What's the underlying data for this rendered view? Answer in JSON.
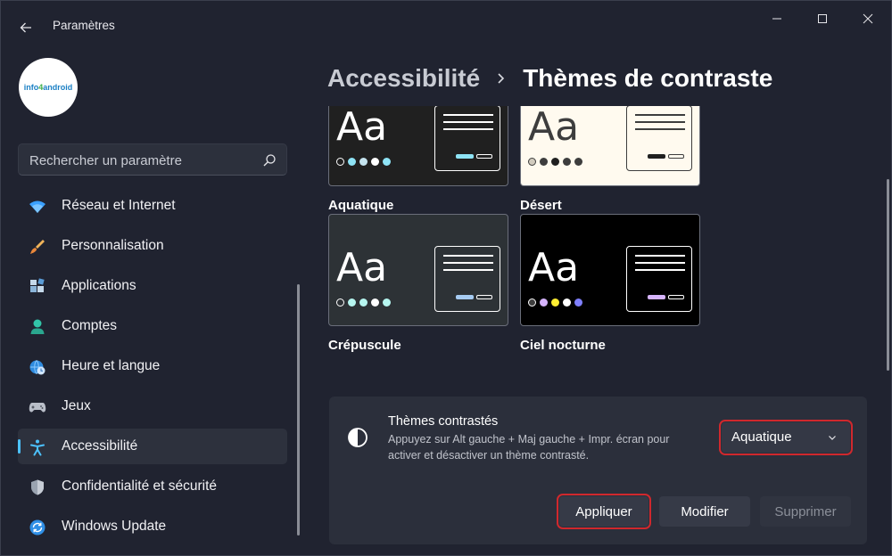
{
  "window": {
    "title": "Paramètres",
    "controls": [
      "minimize-icon",
      "maximize-icon",
      "close-icon"
    ]
  },
  "profile": {
    "logo_text_a": "info",
    "logo_text_b": "4",
    "logo_text_c": "android"
  },
  "search": {
    "placeholder": "Rechercher un paramètre"
  },
  "sidebar": {
    "items": [
      {
        "label": "Réseau et Internet",
        "icon": "wifi-icon"
      },
      {
        "label": "Personnalisation",
        "icon": "brush-icon"
      },
      {
        "label": "Applications",
        "icon": "apps-icon"
      },
      {
        "label": "Comptes",
        "icon": "person-icon"
      },
      {
        "label": "Heure et langue",
        "icon": "globe-clock-icon"
      },
      {
        "label": "Jeux",
        "icon": "gamepad-icon"
      },
      {
        "label": "Accessibilité",
        "icon": "accessibility-icon",
        "active": true
      },
      {
        "label": "Confidentialité et sécurité",
        "icon": "shield-icon"
      },
      {
        "label": "Windows Update",
        "icon": "update-icon"
      }
    ]
  },
  "header": {
    "parent": "Accessibilité",
    "current": "Thèmes de contraste"
  },
  "themes": [
    {
      "name": "Aquatique",
      "sample": "Aa",
      "bg": "#202020",
      "fg": "#ffffff",
      "dots": [
        "#202020",
        "#8ee3f5",
        "#c5e4ef",
        "#ffffff",
        "#8ee3f5"
      ],
      "accent": "#8ee3f5"
    },
    {
      "name": "Désert",
      "sample": "Aa",
      "bg": "#fffaef",
      "fg": "#3d3d3d",
      "dots": [
        "#d1cbbe",
        "#3d3d3d",
        "#202020",
        "#3d3d3d",
        "#3d3d3d"
      ],
      "accent": "#202020"
    },
    {
      "name": "Crépuscule",
      "sample": "Aa",
      "bg": "#2d3236",
      "fg": "#ffffff",
      "dots": [
        "#2d3236",
        "#b6f6f0",
        "#b6f6f0",
        "#ffffff",
        "#b6f6f0"
      ],
      "accent": "#a6cbf2"
    },
    {
      "name": "Ciel nocturne",
      "sample": "Aa",
      "bg": "#000000",
      "fg": "#ffffff",
      "dots": [
        "#3d3d3d",
        "#d6b4fd",
        "#ffee32",
        "#ffffff",
        "#8080ff"
      ],
      "accent": "#d6b4fd"
    }
  ],
  "panel": {
    "title": "Thèmes contrastés",
    "description": "Appuyez sur Alt gauche + Maj gauche + Impr. écran pour activer et désactiver un thème contrasté.",
    "selected": "Aquatique",
    "apply": "Appliquer",
    "modify": "Modifier",
    "delete": "Supprimer"
  },
  "colors": {
    "accent": "#4cc2ff",
    "highlight": "#d0282d"
  }
}
